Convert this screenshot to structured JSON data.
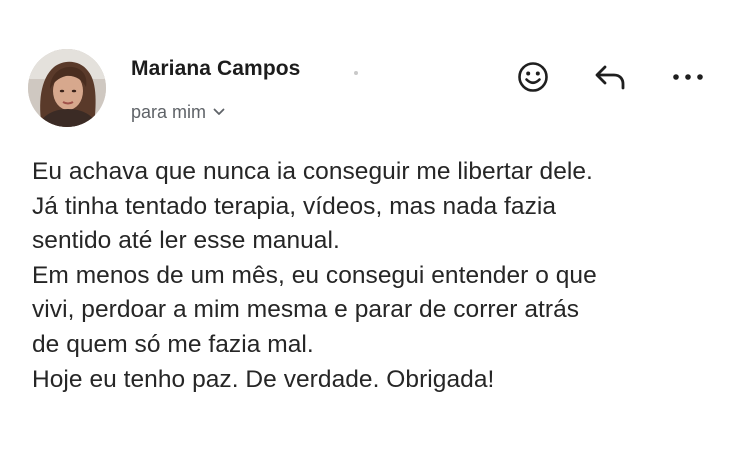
{
  "message": {
    "sender_name": "Mariana Campos",
    "recipient": "para mim",
    "body_lines": [
      "Eu achava que nunca ia conseguir me libertar dele.",
      "Já tinha tentado terapia, vídeos, mas nada fazia",
      "sentido até ler esse manual.",
      "Em menos de um mês, eu consegui entender o que",
      "vivi, perdoar a mim mesma e parar de correr atrás",
      "de quem só me fazia mal.",
      "Hoje eu tenho paz. De verdade. Obrigada!"
    ]
  },
  "icons": {
    "avatar": "avatar-photo",
    "recipient_toggle": "chevron-down-icon",
    "emoji": "emoji-reaction-icon",
    "reply": "reply-icon",
    "more": "more-options-icon"
  },
  "colors": {
    "text": "#262626",
    "secondary_text": "#5f6368",
    "icon": "#1f1f1f"
  }
}
